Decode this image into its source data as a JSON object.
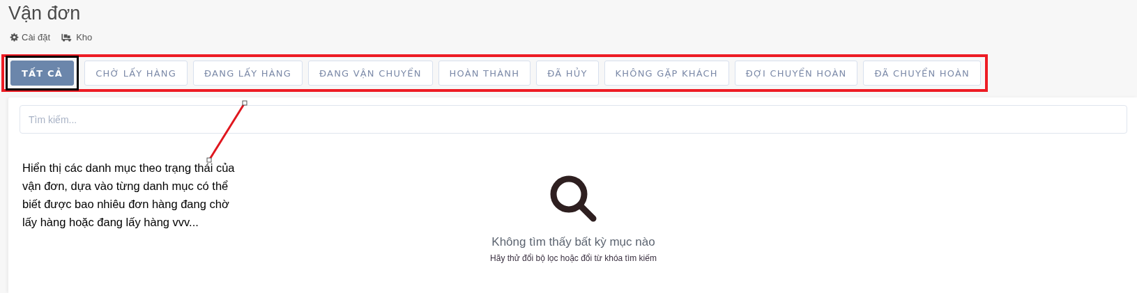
{
  "page": {
    "title": "Vận đơn"
  },
  "header_links": [
    {
      "kind": "settings",
      "label": "Cài đặt"
    },
    {
      "kind": "warehouse",
      "label": "Kho"
    }
  ],
  "tabs": [
    {
      "label": "TẤT CẢ",
      "selected": true
    },
    {
      "label": "CHỜ LẤY HÀNG",
      "selected": false
    },
    {
      "label": "ĐANG LẤY HÀNG",
      "selected": false
    },
    {
      "label": "ĐANG VẬN CHUYỂN",
      "selected": false
    },
    {
      "label": "HOÀN THÀNH",
      "selected": false
    },
    {
      "label": "ĐÃ HỦY",
      "selected": false
    },
    {
      "label": "KHÔNG GẶP KHÁCH",
      "selected": false
    },
    {
      "label": "ĐỢI CHUYỂN HOÀN",
      "selected": false
    },
    {
      "label": "ĐÃ CHUYỂN HOÀN",
      "selected": false
    }
  ],
  "search": {
    "placeholder": "Tìm kiếm..."
  },
  "empty_state": {
    "title": "Không tìm thấy bất kỳ mục nào",
    "hint": "Hãy thử đổi bộ lọc hoặc đổi từ khóa tìm kiếm"
  },
  "annotation": {
    "text": "Hiển thị các danh mục theo trạng thái của vận đơn, dựa vào từng danh mục có thể biết được bao nhiêu đơn hàng đang chờ lấy hàng hoặc đang lấy hàng vvv..."
  }
}
